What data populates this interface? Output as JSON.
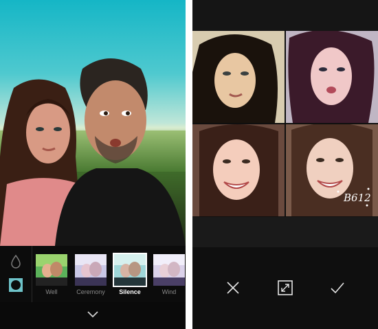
{
  "left_screen": {
    "filters": [
      {
        "label": "Well",
        "selected": false
      },
      {
        "label": "Ceremony",
        "selected": false
      },
      {
        "label": "Silence",
        "selected": true
      },
      {
        "label": "Wind",
        "selected": false
      }
    ],
    "tools": [
      "drop-icon",
      "circle-tool-icon"
    ],
    "bottom_icon": "chevron-down-icon"
  },
  "right_screen": {
    "sticker_text": "B612",
    "actions": [
      "close-icon",
      "expand-icon",
      "checkmark-icon"
    ]
  },
  "colors": {
    "sky": "#15b6c6",
    "panel_bg": "#0c0c0c",
    "label_inactive": "#8a8a8a",
    "label_active": "#ffffff"
  }
}
